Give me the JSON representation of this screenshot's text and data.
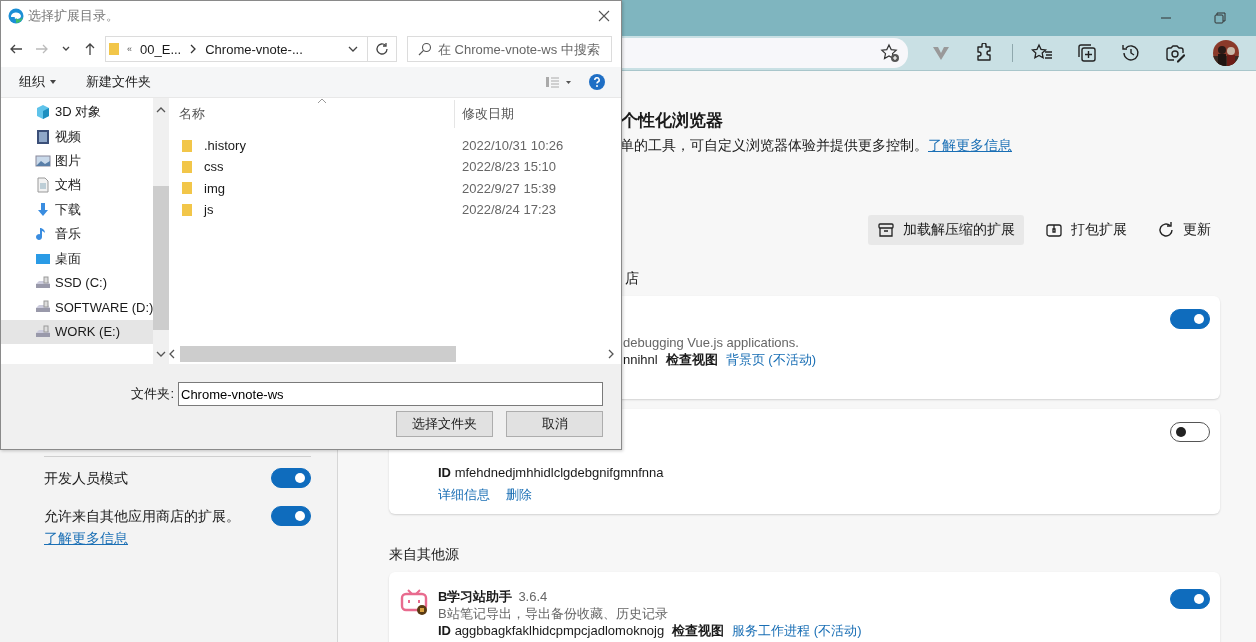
{
  "sidebar": {
    "settings": [
      {
        "label": "开发人员模式",
        "on": true
      },
      {
        "label": "允许来自其他应用商店的扩展。",
        "link": "了解更多信息",
        "on": true
      }
    ]
  },
  "main": {
    "heading": "个性化浏览器",
    "description": "单的工具，可自定义浏览器体验并提供更多控制。",
    "description_link": "了解更多信息",
    "actions": [
      {
        "label": "加载解压缩的扩展",
        "hovered": true
      },
      {
        "label": "打包扩展",
        "hovered": false
      },
      {
        "label": "更新",
        "hovered": false
      }
    ],
    "store_heading": "店",
    "store_extensions": [
      {
        "kind": "partial",
        "description": "debugging Vue.js applications.",
        "id": "nnihnl",
        "inspect": "检查视图",
        "view_link": "背景页 (不活动)",
        "enabled": true
      },
      {
        "kind": "idonly",
        "id_label": "ID",
        "id": "mfehdnedjmhhidlclgdebgnifgmnfnna",
        "links": [
          "详细信息",
          "删除"
        ],
        "enabled": false
      }
    ],
    "other_heading": "来自其他源",
    "other_extensions": [
      {
        "kind": "full",
        "name": "B学习站助手",
        "version": "3.6.4",
        "description": "B站笔记导出，导出备份收藏、历史记录",
        "id_label": "ID",
        "id": "aggbbagkfaklhidcpmpcjadlomoknojg",
        "inspect": "检查视图",
        "view_link": "服务工作进程 (不活动)",
        "enabled": true
      }
    ]
  },
  "dialog": {
    "title": "选择扩展目录。",
    "path": [
      "«",
      "00_E...",
      "Chrome-vnote-..."
    ],
    "search": {
      "placeholder": "在 Chrome-vnote-ws 中搜索"
    },
    "commands": [
      {
        "label": "组织",
        "dropdown": true
      },
      {
        "label": "新建文件夹",
        "dropdown": false
      }
    ],
    "nav_items": [
      {
        "label": "3D 对象",
        "kind": "cube",
        "selected": false
      },
      {
        "label": "视频",
        "kind": "video",
        "selected": false
      },
      {
        "label": "图片",
        "kind": "picture",
        "selected": false
      },
      {
        "label": "文档",
        "kind": "document",
        "selected": false
      },
      {
        "label": "下载",
        "kind": "download",
        "selected": false
      },
      {
        "label": "音乐",
        "kind": "music",
        "selected": false
      },
      {
        "label": "桌面",
        "kind": "desktop",
        "selected": false
      },
      {
        "label": "SSD (C:)",
        "kind": "drive",
        "selected": false
      },
      {
        "label": "SOFTWARE (D:)",
        "kind": "drive",
        "selected": false
      },
      {
        "label": "WORK (E:)",
        "kind": "drive",
        "selected": true
      }
    ],
    "columns": [
      "名称",
      "修改日期"
    ],
    "files": [
      {
        "name": ".history",
        "modified": "2022/10/31 10:26"
      },
      {
        "name": "css",
        "modified": "2022/8/23 15:10"
      },
      {
        "name": "img",
        "modified": "2022/9/27 15:39"
      },
      {
        "name": "js",
        "modified": "2022/8/24 17:23"
      }
    ],
    "folder_label": "文件夹:",
    "folder_value": "Chrome-vnote-ws",
    "buttons": [
      "选择文件夹",
      "取消"
    ]
  }
}
